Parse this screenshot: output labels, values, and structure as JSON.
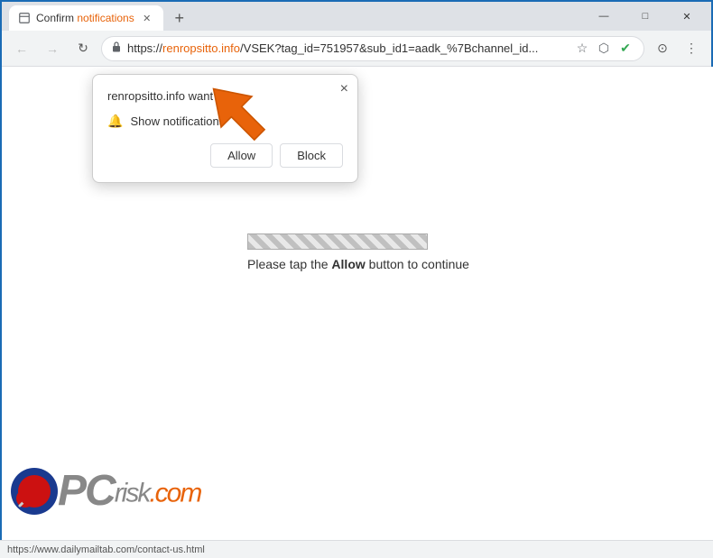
{
  "titlebar": {
    "tab_title_prefix": "Confirm ",
    "tab_title_orange": "notifications",
    "new_tab_label": "+",
    "window_controls": {
      "minimize": "—",
      "maximize": "□",
      "close": "✕"
    }
  },
  "addressbar": {
    "back_label": "←",
    "forward_label": "→",
    "refresh_label": "↻",
    "url_prefix": "https://",
    "url_orange": "renropsitto.info",
    "url_rest": "/VSEK?tag_id=751957&sub_id1=aadk_%7Bchannel_id...",
    "star_icon": "☆",
    "extensions_icon": "⬡",
    "shield_icon": "✔",
    "profile_icon": "⊙",
    "menu_icon": "⋮"
  },
  "popup": {
    "title_prefix": "renropsitto.info want",
    "close_label": "×",
    "notification_row_label": "Show notifications",
    "allow_button": "Allow",
    "block_button": "Block"
  },
  "content": {
    "progress_text_prefix": "Please tap the ",
    "progress_text_bold": "Allow",
    "progress_text_suffix": " button to continue"
  },
  "pcrisk": {
    "text_pc": "PC",
    "text_risk": "risk",
    "text_dot": ".",
    "text_com": "com"
  },
  "statusbar": {
    "url": "https://www.dailymailtab.com/contact-us.html"
  }
}
